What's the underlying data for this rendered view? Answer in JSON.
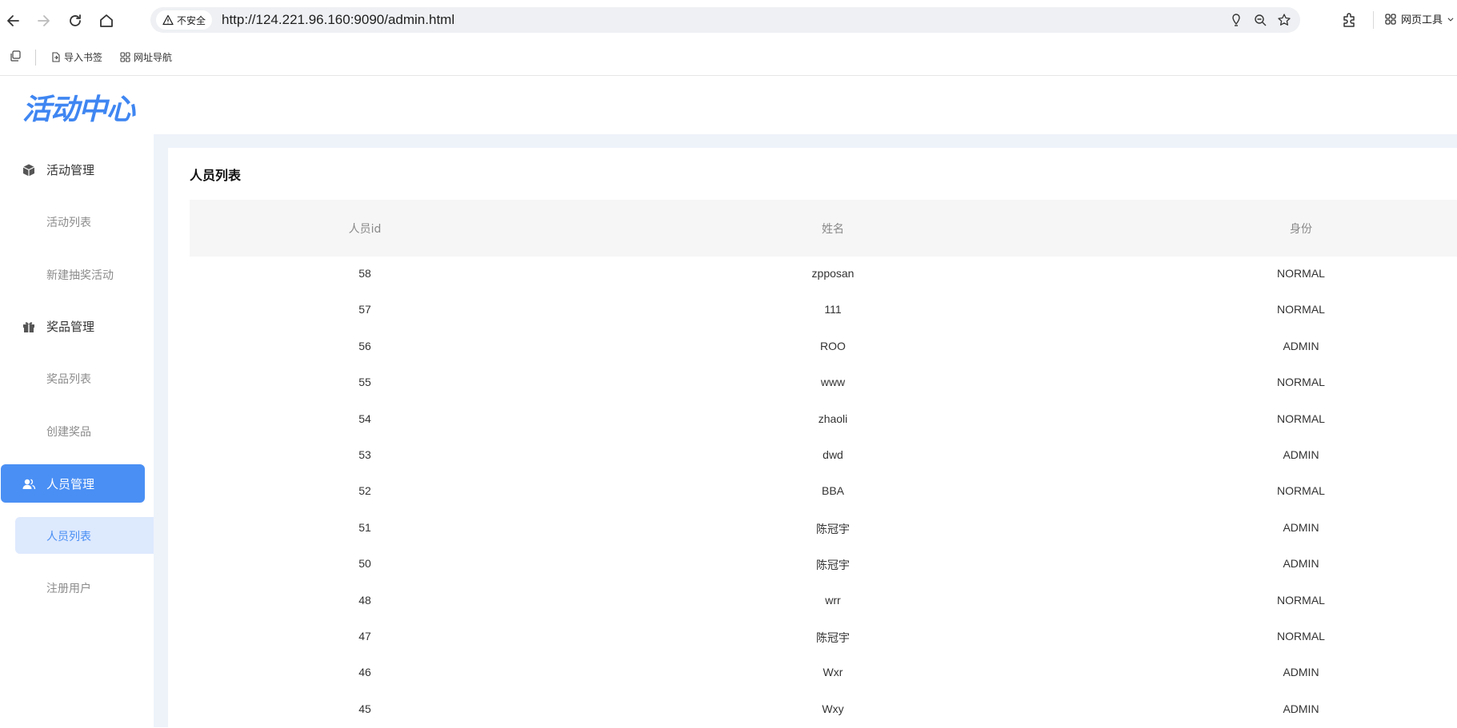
{
  "browser": {
    "insecure_label": "不安全",
    "url": "http://124.221.96.160:9090/admin.html",
    "web_tools_label": "网页工具",
    "bookmarks": [
      {
        "label": "导入书签"
      },
      {
        "label": "网址导航"
      }
    ]
  },
  "app": {
    "logo": "活动中心",
    "sidebar": [
      {
        "label": "活动管理",
        "icon": "box-icon",
        "children": [
          "活动列表",
          "新建抽奖活动"
        ]
      },
      {
        "label": "奖品管理",
        "icon": "gift-icon",
        "children": [
          "奖品列表",
          "创建奖品"
        ]
      },
      {
        "label": "人员管理",
        "icon": "users-icon",
        "active": true,
        "children": [
          "人员列表",
          "注册用户"
        ],
        "active_child": "人员列表"
      }
    ],
    "accent_color": "#4a8ff4"
  },
  "main": {
    "title": "人员列表",
    "columns": [
      "人员id",
      "姓名",
      "身份"
    ],
    "rows": [
      [
        "58",
        "zpposan",
        "NORMAL"
      ],
      [
        "57",
        "111",
        "NORMAL"
      ],
      [
        "56",
        "ROO",
        "ADMIN"
      ],
      [
        "55",
        "www",
        "NORMAL"
      ],
      [
        "54",
        "zhaoli",
        "NORMAL"
      ],
      [
        "53",
        "dwd",
        "ADMIN"
      ],
      [
        "52",
        "BBA",
        "NORMAL"
      ],
      [
        "51",
        "陈冠宇",
        "ADMIN"
      ],
      [
        "50",
        "陈冠宇",
        "ADMIN"
      ],
      [
        "48",
        "wrr",
        "NORMAL"
      ],
      [
        "47",
        "陈冠宇",
        "NORMAL"
      ],
      [
        "46",
        "Wxr",
        "ADMIN"
      ],
      [
        "45",
        "Wxy",
        "ADMIN"
      ]
    ]
  }
}
